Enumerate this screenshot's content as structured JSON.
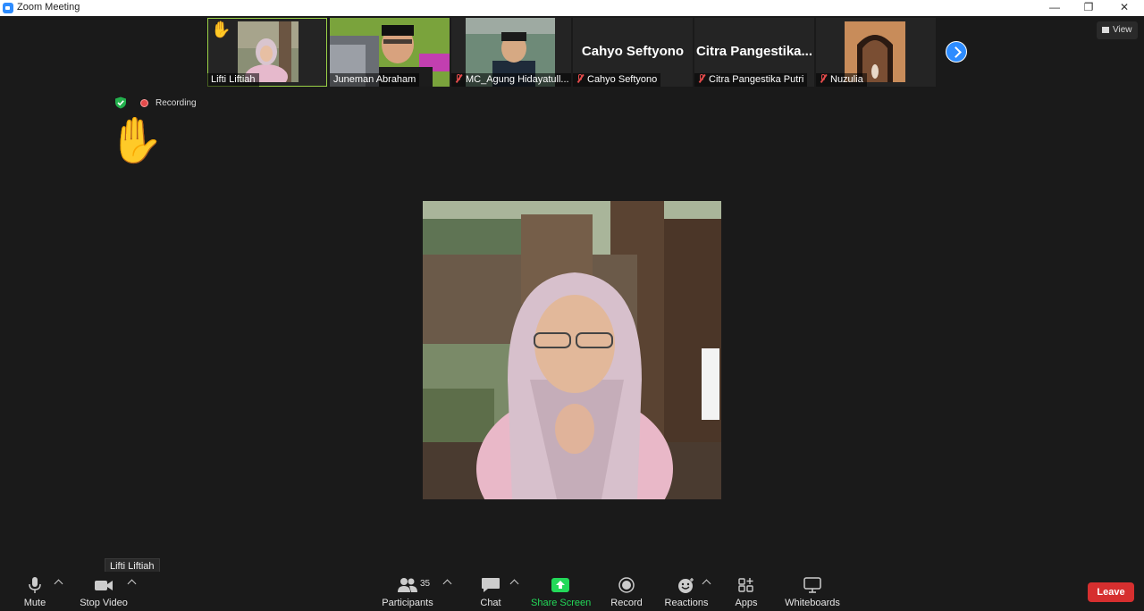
{
  "window": {
    "title": "Zoom Meeting",
    "minimize": "—",
    "restore": "❐",
    "close": "✕"
  },
  "view_button": "View",
  "participants_strip": [
    {
      "name": "Lifti Liftiah",
      "raised_hand": true,
      "muted": false,
      "type": "video",
      "active": true
    },
    {
      "name": "Juneman Abraham",
      "muted": false,
      "type": "video"
    },
    {
      "name": "MC_Agung Hidayatull...",
      "muted": true,
      "type": "video"
    },
    {
      "name": "Cahyo Seftyono",
      "big_name": "Cahyo Seftyono",
      "muted": true,
      "type": "name"
    },
    {
      "name": "Citra Pangestika Putri",
      "big_name": "Citra  Pangestika...",
      "muted": true,
      "type": "name"
    },
    {
      "name": "Nuzulia",
      "muted": true,
      "type": "video"
    }
  ],
  "status": {
    "recording_label": "Recording",
    "shield_icon": "shield-check-icon",
    "hand_emoji": "✋"
  },
  "tooltip": "Lifti Liftiah",
  "toolbar": {
    "mute": "Mute",
    "stop_video": "Stop Video",
    "participants": "Participants",
    "participants_count": "35",
    "chat": "Chat",
    "share_screen": "Share Screen",
    "record": "Record",
    "reactions": "Reactions",
    "apps": "Apps",
    "whiteboards": "Whiteboards",
    "leave": "Leave"
  },
  "colors": {
    "share_green": "#23d959",
    "leave_red": "#d62f2f",
    "accent_blue": "#2d8cff",
    "active_border": "#9bd247"
  }
}
